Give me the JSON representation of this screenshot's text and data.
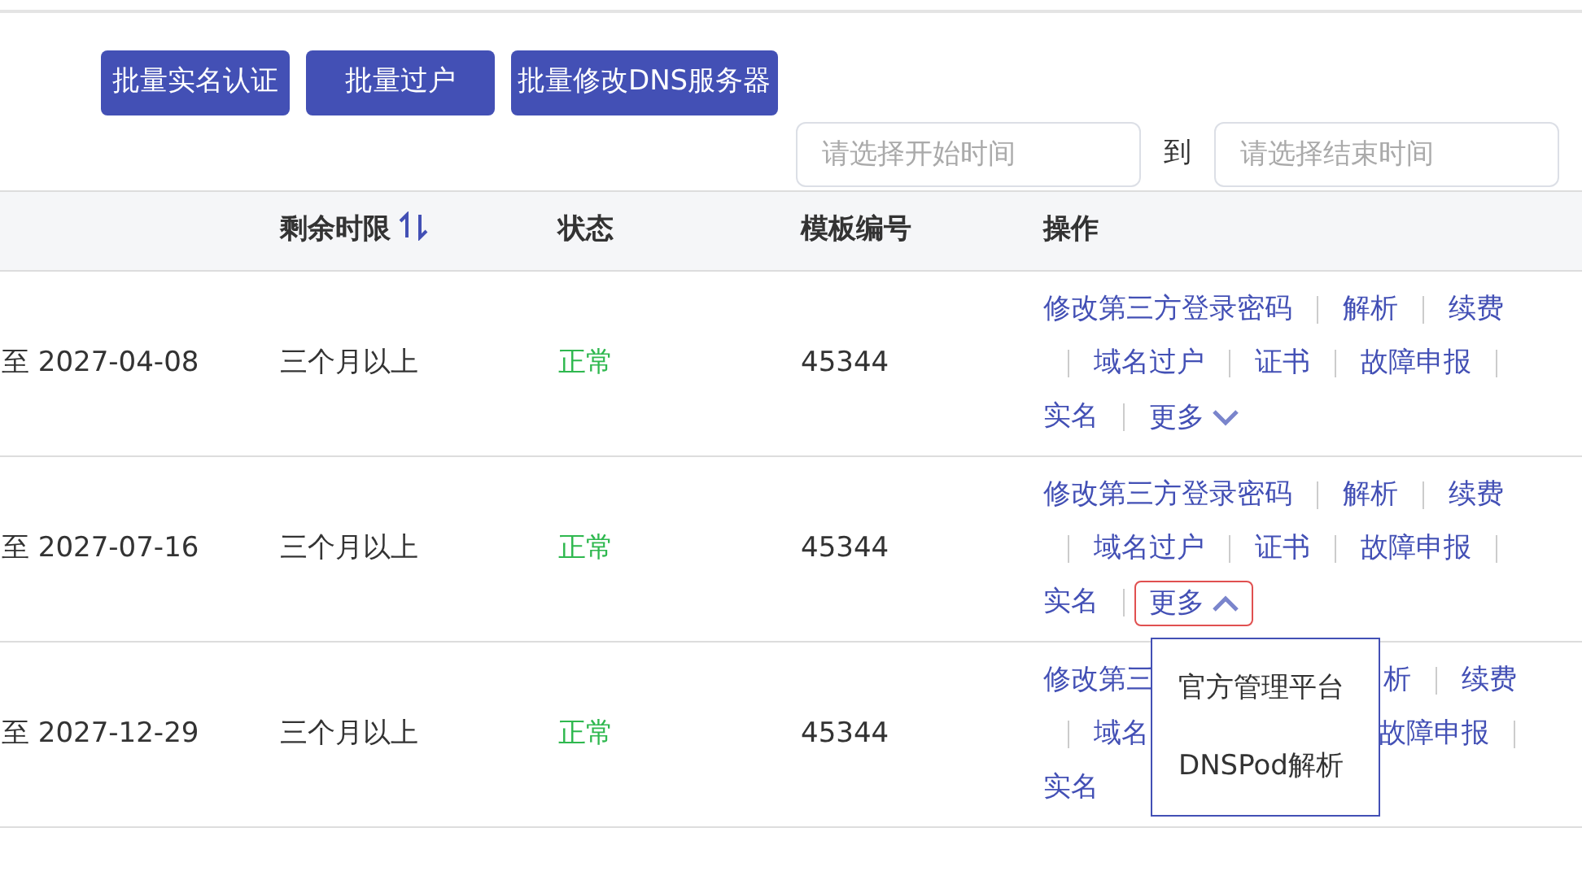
{
  "toolbar": {
    "buttons": [
      "批量实名认证",
      "批量过户",
      "批量修改DNS服务器"
    ]
  },
  "date_range": {
    "start_placeholder": "请选择开始时间",
    "separator": "到",
    "end_placeholder": "请选择结束时间"
  },
  "table": {
    "columns": [
      {
        "label": "剩余时限",
        "sortable": true
      },
      {
        "label": "状态"
      },
      {
        "label": "模板编号"
      },
      {
        "label": "操作"
      }
    ],
    "rows": [
      {
        "expiry": "至 2027-04-08",
        "remaining": "三个月以上",
        "status": "正常",
        "template": "45344",
        "actions": [
          [
            {
              "text": "修改第三方登录密码"
            },
            {
              "text": "解析"
            },
            {
              "text": "续费"
            }
          ],
          [
            {
              "text": "域名过户"
            },
            {
              "text": "证书"
            },
            {
              "text": "故障申报"
            }
          ],
          [
            {
              "text": "实名"
            },
            {
              "text": "更多",
              "kind": "more",
              "expanded": false
            }
          ]
        ]
      },
      {
        "expiry": "至 2027-07-16",
        "remaining": "三个月以上",
        "status": "正常",
        "template": "45344",
        "actions": [
          [
            {
              "text": "修改第三方登录密码"
            },
            {
              "text": "解析"
            },
            {
              "text": "续费"
            }
          ],
          [
            {
              "text": "域名过户"
            },
            {
              "text": "证书"
            },
            {
              "text": "故障申报"
            }
          ],
          [
            {
              "text": "实名"
            },
            {
              "text": "更多",
              "kind": "more",
              "expanded": true,
              "menu": [
                "官方管理平台",
                "DNSPod解析"
              ]
            }
          ]
        ]
      },
      {
        "expiry": "至 2027-12-29",
        "remaining": "三个月以上",
        "status": "正常",
        "template": "45344",
        "actions": [
          [
            {
              "text": "修改第三",
              "covered": true
            },
            {
              "text": "析"
            },
            {
              "text": "续费"
            }
          ],
          [
            {
              "text": "域名",
              "covered": true
            },
            {
              "text": "故障申报"
            }
          ],
          [
            {
              "text": "实名"
            }
          ]
        ]
      }
    ]
  }
}
